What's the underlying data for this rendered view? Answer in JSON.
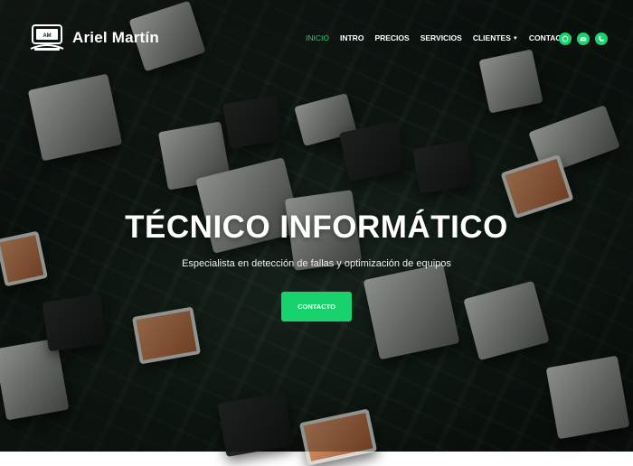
{
  "brand": {
    "name": "Ariel Martín",
    "logo_icon": "computer-monitor-icon",
    "logo_tag": "AM"
  },
  "nav": {
    "active_color": "#18d26e",
    "items": [
      {
        "label": "INICIO",
        "active": true
      },
      {
        "label": "INTRO"
      },
      {
        "label": "PRECIOS"
      },
      {
        "label": "SERVICIOS"
      },
      {
        "label": "CLIENTES",
        "dropdown": true
      },
      {
        "label": "CONTACTO"
      }
    ]
  },
  "social": [
    {
      "icon": "whatsapp-icon"
    },
    {
      "icon": "email-icon"
    },
    {
      "icon": "phone-icon"
    }
  ],
  "hero": {
    "title": "TÉCNICO INFORMÁTICO",
    "subtitle": "Especialista en detección de fallas y optimización de equipos",
    "cta_label": "CONTACTO"
  },
  "accent_color": "#18d26e"
}
